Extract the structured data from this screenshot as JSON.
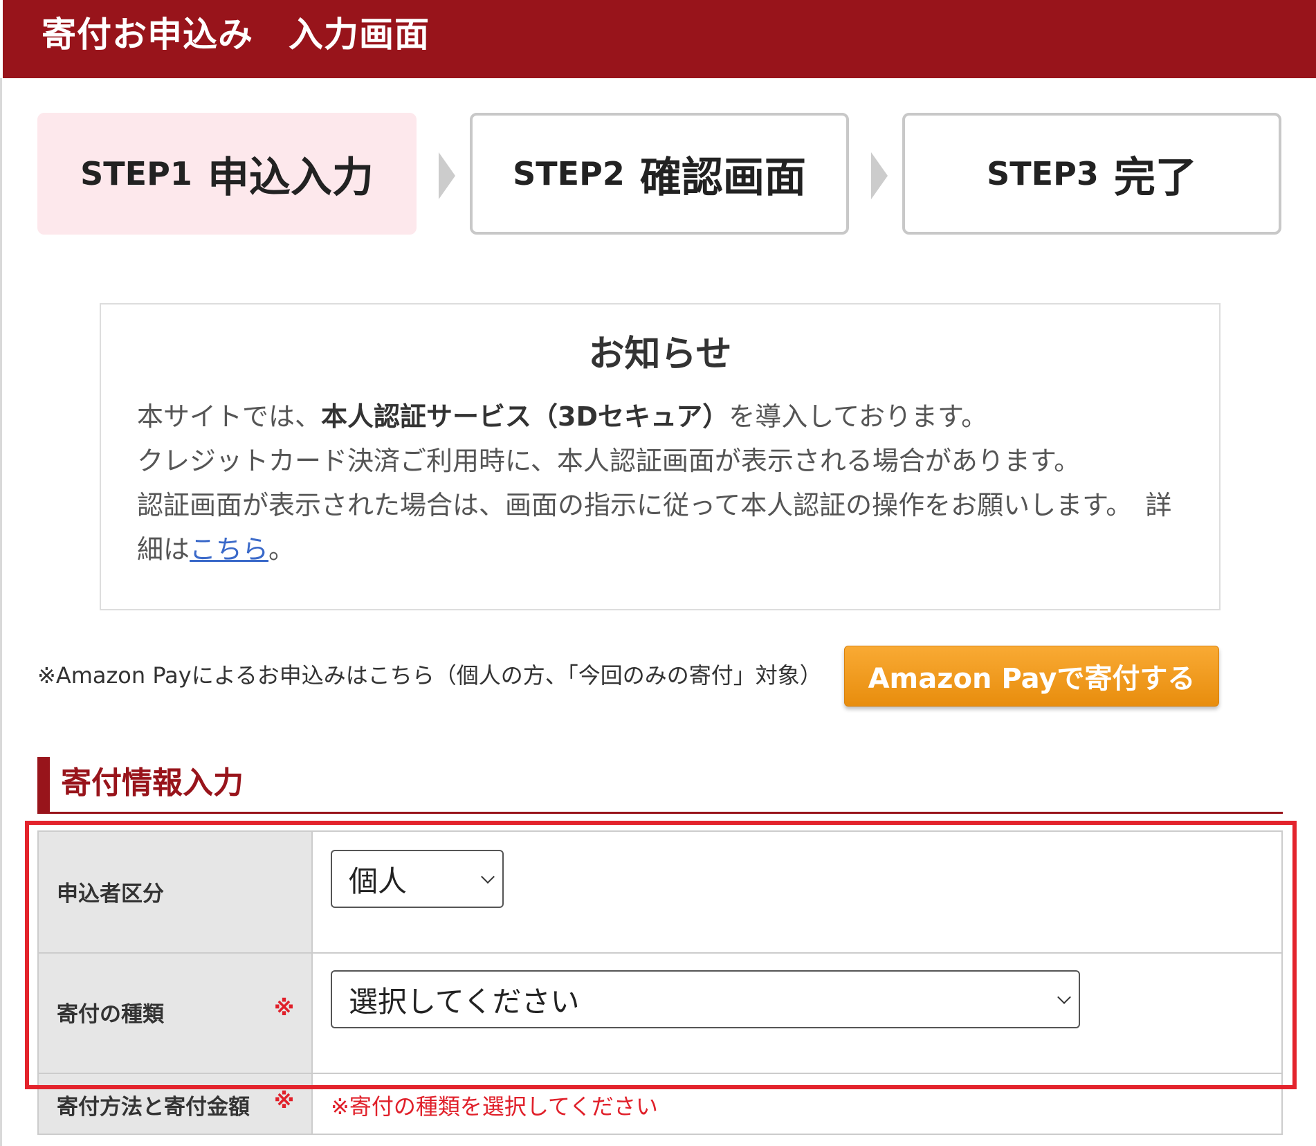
{
  "header": {
    "title": "寄付お申込み　入力画面"
  },
  "steps": [
    {
      "num": "STEP1",
      "label": "申込入力"
    },
    {
      "num": "STEP2",
      "label": "確認画面"
    },
    {
      "num": "STEP3",
      "label": "完了"
    }
  ],
  "notice": {
    "title": "お知らせ",
    "line1_pre": "本サイトでは、",
    "line1_bold": "本人認証サービス（3Dセキュア）",
    "line1_post": "を導入しております。",
    "line2": "クレジットカード決済ご利用時に、本人認証画面が表示される場合があります。",
    "line3": "認証画面が表示された場合は、画面の指示に従って本人認証の操作をお願いします。",
    "detail_pre": "詳細は",
    "detail_link": "こちら",
    "detail_post": "。"
  },
  "amazon": {
    "note": "※Amazon Payによるお申込みはこちら（個人の方、「今回のみの寄付」対象）",
    "button": "Amazon Payで寄付する"
  },
  "section": {
    "title": "寄付情報入力"
  },
  "form": {
    "applicant_type": {
      "label": "申込者区分",
      "value": "個人"
    },
    "donation_type": {
      "label": "寄付の種類",
      "required_mark": "※",
      "value": "選択してください"
    },
    "method_amount": {
      "label": "寄付方法と寄付金額",
      "required_mark": "※",
      "error": "※寄付の種類を選択してください"
    }
  },
  "colors": {
    "brand_red": "#98141b",
    "active_step_bg": "#fde8ec",
    "amazon_orange": "#f39a1c",
    "highlight": "#e3232c"
  }
}
